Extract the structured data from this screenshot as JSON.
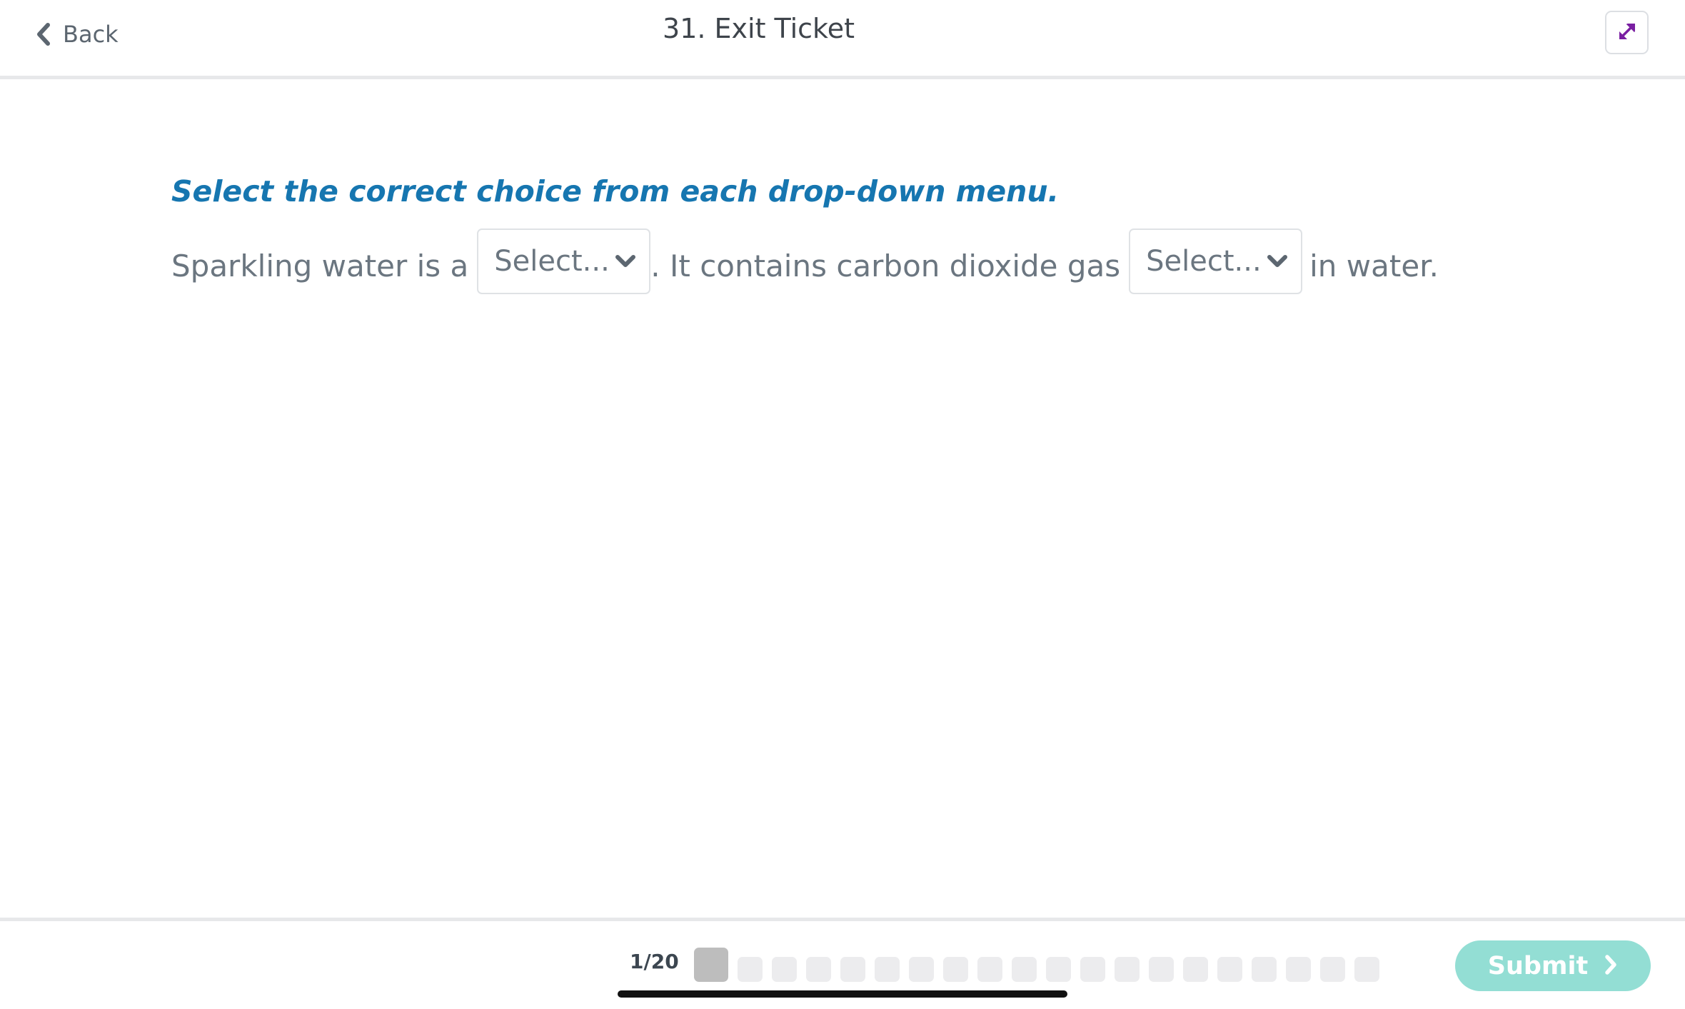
{
  "header": {
    "back_label": "Back",
    "title": "31. Exit Ticket",
    "expand_icon": "expand-arrows-icon",
    "expand_color": "#7a1fa2"
  },
  "question": {
    "instruction": "Select the correct choice from each drop-down menu.",
    "part1": "Sparkling water is a",
    "dropdown1_value": "Select...",
    "part2": ". It contains carbon dioxide gas",
    "dropdown2_value": "Select...",
    "part3": "in water."
  },
  "footer": {
    "page_counter": "1/20",
    "current_question": 1,
    "total_questions": 20,
    "submit_label": "Submit",
    "submit_color": "#93ded4"
  },
  "colors": {
    "instruction": "#1676b0",
    "body_text": "#6b7680"
  }
}
